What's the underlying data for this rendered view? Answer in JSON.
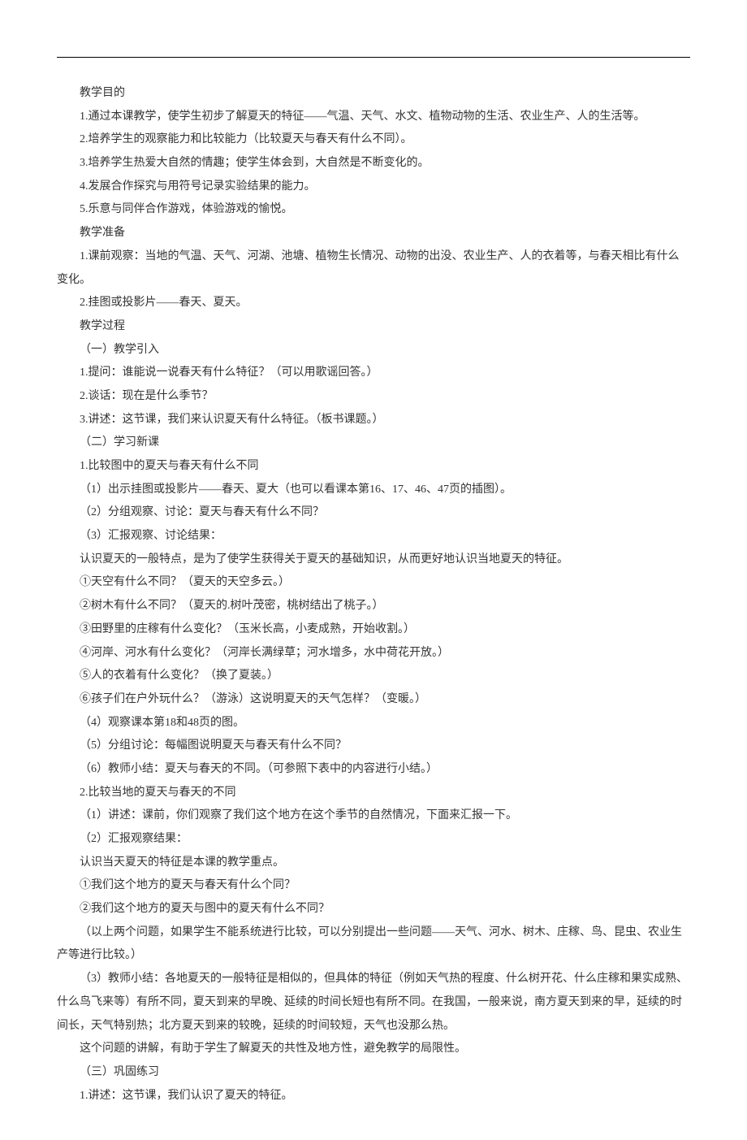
{
  "paragraphs": [
    "教学目的",
    "1.通过本课教学，使学生初步了解夏天的特征——气温、天气、水文、植物动物的生活、农业生产、人的生活等。",
    "2.培养学生的观察能力和比较能力（比较夏天与春天有什么不同）。",
    "3.培养学生热爱大自然的情趣；使学生体会到，大自然是不断变化的。",
    "4.发展合作探究与用符号记录实验结果的能力。",
    "5.乐意与同伴合作游戏，体验游戏的愉悦。",
    "教学准备",
    "1.课前观察：当地的气温、天气、河湖、池塘、植物生长情况、动物的出没、农业生产、人的衣着等，与春天相比有什么变化。",
    "2.挂图或投影片——春天、夏天。",
    "教学过程",
    "（一）教学引入",
    "1.提问：谁能说一说春天有什么特征？（可以用歌谣回答。）",
    "2.谈话：现在是什么季节？",
    "3.讲述：这节课，我们来认识夏天有什么特征。（板书课题。）",
    "（二）学习新课",
    "1.比较图中的夏天与春天有什么不同",
    "（1）出示挂图或投影片——春天、夏大（也可以看课本第16、17、46、47页的插图）。",
    "（2）分组观察、讨论：夏天与春天有什么不同？",
    "（3）汇报观察、讨论结果：",
    "认识夏天的一般特点，是为了使学生获得关于夏天的基础知识，从而更好地认识当地夏天的特征。",
    "①天空有什么不同？（夏天的天空多云。）",
    "②树木有什么不同？（夏天的.树叶茂密，桃树结出了桃子。）",
    "③田野里的庄稼有什么变化？（玉米长高，小麦成熟，开始收割。）",
    "④河岸、河水有什么变化？（河岸长满绿草；河水增多，水中荷花开放。）",
    "⑤人的衣着有什么变化？（换了夏装。）",
    "⑥孩子们在户外玩什么？（游泳）这说明夏天的天气怎样？（变暖。）",
    "（4）观察课本第18和48页的图。",
    "（5）分组讨论：每幅图说明夏天与春天有什么不同？",
    "（6）教师小结：夏天与春天的不同。（可参照下表中的内容进行小结。）",
    "2.比较当地的夏天与春天的不同",
    "（1）讲述：课前，你们观察了我们这个地方在这个季节的自然情况，下面来汇报一下。",
    "（2）汇报观察结果：",
    "认识当天夏天的特征是本课的教学重点。",
    "①我们这个地方的夏天与春天有什么个同？",
    "②我们这个地方的夏天与图中的夏天有什么不同？",
    "（以上两个问题，如果学生不能系统进行比较，可以分别提出一些问题——天气、河水、树木、庄稼、鸟、昆虫、农业生产等进行比较。）",
    "（3）教师小结：各地夏天的一般特征是相似的，但具体的特征（例如天气热的程度、什么树开花、什么庄稼和果实成熟、什么鸟飞来等）有所不同，夏天到来的早晚、延续的时间长短也有所不同。在我国，一般来说，南方夏天到来的早，延续的时间长，天气特别热；北方夏天到来的较晚，延续的时间较短，天气也没那么热。",
    "这个问题的讲解，有助于学生了解夏天的共性及地方性，避免教学的局限性。",
    "（三）巩固练习",
    "1.讲述：这节课，我们认识了夏天的特征。"
  ]
}
